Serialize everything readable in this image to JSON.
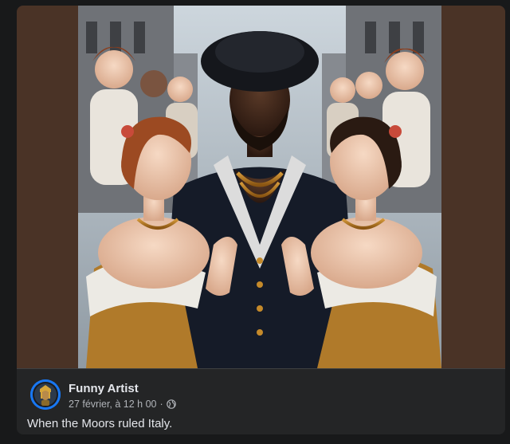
{
  "post": {
    "author": "Funny Artist",
    "timestamp": "27 février, à 12 h 00",
    "separator": "·",
    "privacy_icon": "globe-icon",
    "caption": "When the Moors ruled Italy."
  },
  "colors": {
    "page_background": "#18191a",
    "card_background": "#242526",
    "media_letterbox": "#4a3326",
    "primary_text": "#e4e6eb",
    "secondary_text": "#b0b3b8",
    "avatar_ring": "#1877f2"
  }
}
